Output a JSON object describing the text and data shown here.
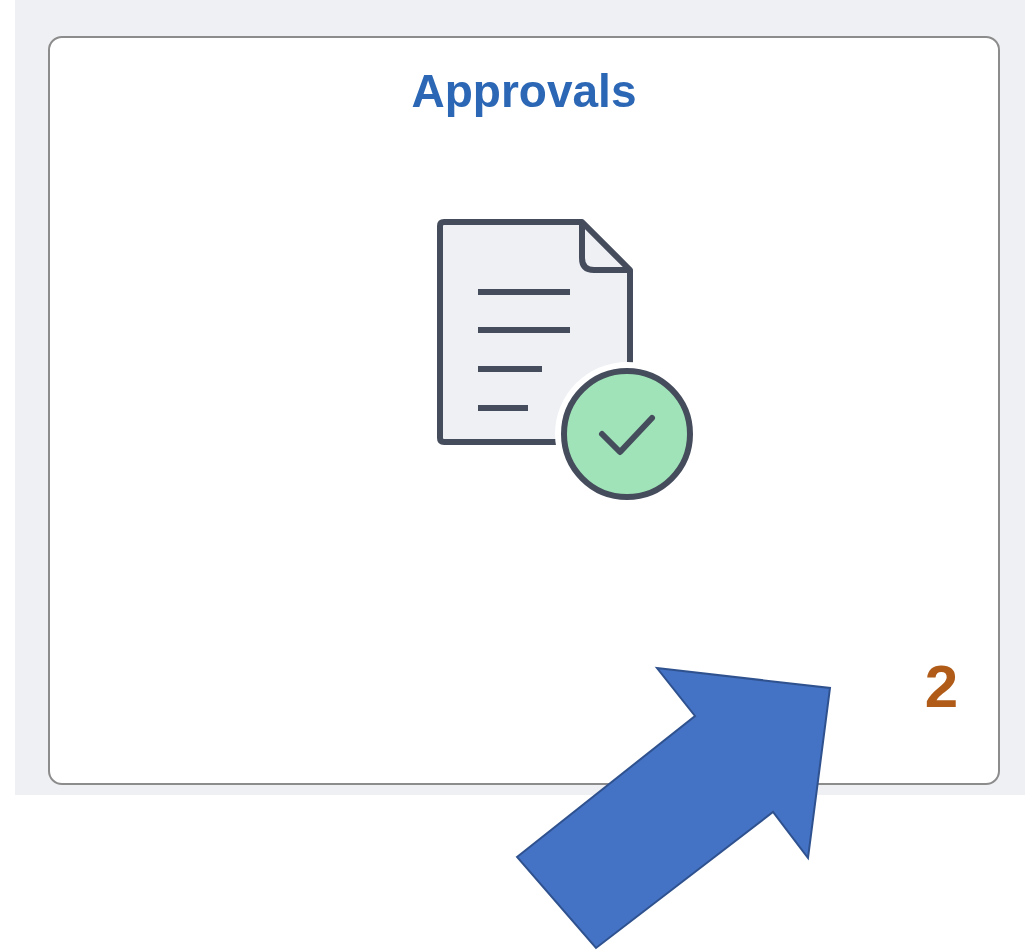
{
  "tile": {
    "title": "Approvals",
    "count": "2"
  }
}
